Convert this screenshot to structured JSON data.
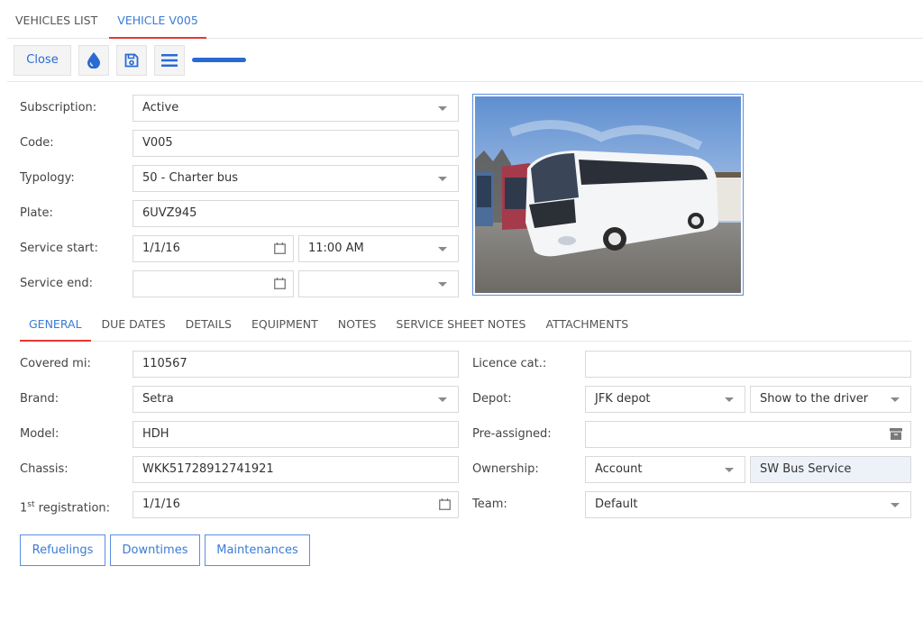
{
  "top_tabs": [
    {
      "label": "VEHICLES LIST",
      "active": false
    },
    {
      "label": "VEHICLE V005",
      "active": true
    }
  ],
  "toolbar": {
    "close_label": "Close",
    "icons": [
      "water-drop-icon",
      "save-icon",
      "menu-icon"
    ],
    "accent_color": "#2a6ad2"
  },
  "header_form": {
    "subscription": {
      "label": "Subscription:",
      "value": "Active"
    },
    "code": {
      "label": "Code:",
      "value": "V005"
    },
    "typology": {
      "label": "Typology:",
      "value": "50 - Charter bus"
    },
    "plate": {
      "label": "Plate:",
      "value": "6UVZ945"
    },
    "service_start": {
      "label": "Service start:",
      "date": "1/1/16",
      "time": "11:00 AM"
    },
    "service_end": {
      "label": "Service end:",
      "date": "",
      "time": ""
    }
  },
  "photo": {
    "alt": "White Setra charter bus"
  },
  "sub_tabs": [
    {
      "label": "GENERAL",
      "active": true
    },
    {
      "label": "DUE DATES",
      "active": false
    },
    {
      "label": "DETAILS",
      "active": false
    },
    {
      "label": "EQUIPMENT",
      "active": false
    },
    {
      "label": "NOTES",
      "active": false
    },
    {
      "label": "SERVICE SHEET NOTES",
      "active": false
    },
    {
      "label": "ATTACHMENTS",
      "active": false
    }
  ],
  "general": {
    "covered_mi": {
      "label": "Covered mi:",
      "value": "110567"
    },
    "brand": {
      "label": "Brand:",
      "value": "Setra"
    },
    "model": {
      "label": "Model:",
      "value": "HDH"
    },
    "chassis": {
      "label": "Chassis:",
      "value": "WKK51728912741921"
    },
    "first_registration": {
      "label_prefix": "1",
      "label_sup": "st",
      "label_suffix": " registration:",
      "value": "1/1/16"
    },
    "licence_cat": {
      "label": "Licence cat.:",
      "value": ""
    },
    "depot": {
      "label": "Depot:",
      "value": "JFK depot",
      "visibility": "Show to the driver"
    },
    "pre_assigned": {
      "label": "Pre-assigned:",
      "value": ""
    },
    "ownership": {
      "label": "Ownership:",
      "type": "Account",
      "value": "SW Bus Service"
    },
    "team": {
      "label": "Team:",
      "value": "Default"
    }
  },
  "actions": [
    {
      "label": "Refuelings"
    },
    {
      "label": "Downtimes"
    },
    {
      "label": "Maintenances"
    }
  ]
}
